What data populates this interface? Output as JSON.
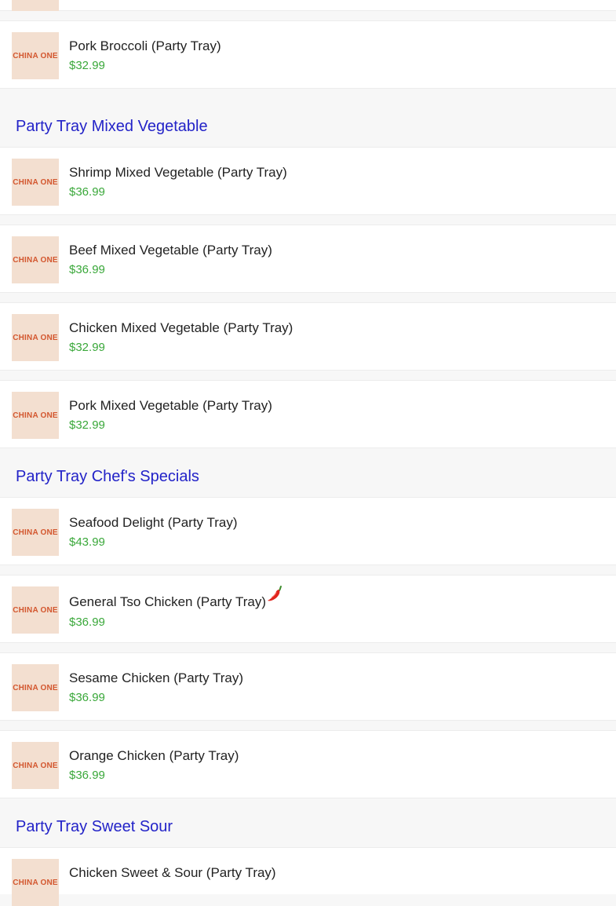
{
  "thumbnail_text": "CHINA ONE",
  "colors": {
    "category_title": "#2323c8",
    "price": "#3aa83a",
    "thumbnail_bg": "#f3dfd0",
    "thumbnail_text": "#d3572f"
  },
  "icons": {
    "spicy": "chili-pepper-icon"
  },
  "top_item": {
    "name": "Pork Broccoli (Party Tray)",
    "price": "$32.99"
  },
  "categories": [
    {
      "title": "Party Tray Mixed Vegetable",
      "items": [
        {
          "name": "Shrimp Mixed Vegetable (Party Tray)",
          "price": "$36.99"
        },
        {
          "name": "Beef Mixed Vegetable (Party Tray)",
          "price": "$36.99"
        },
        {
          "name": "Chicken Mixed Vegetable (Party Tray)",
          "price": "$32.99"
        },
        {
          "name": "Pork Mixed Vegetable (Party Tray)",
          "price": "$32.99"
        }
      ]
    },
    {
      "title": "Party Tray Chef's Specials",
      "items": [
        {
          "name": "Seafood Delight (Party Tray)",
          "price": "$43.99"
        },
        {
          "name": "General Tso Chicken (Party Tray)",
          "price": "$36.99",
          "spicy": true
        },
        {
          "name": "Sesame Chicken (Party Tray)",
          "price": "$36.99"
        },
        {
          "name": "Orange Chicken (Party Tray)",
          "price": "$36.99"
        }
      ]
    },
    {
      "title": "Party Tray Sweet Sour",
      "items": [
        {
          "name": "Chicken Sweet & Sour (Party Tray)",
          "price": ""
        }
      ]
    }
  ]
}
